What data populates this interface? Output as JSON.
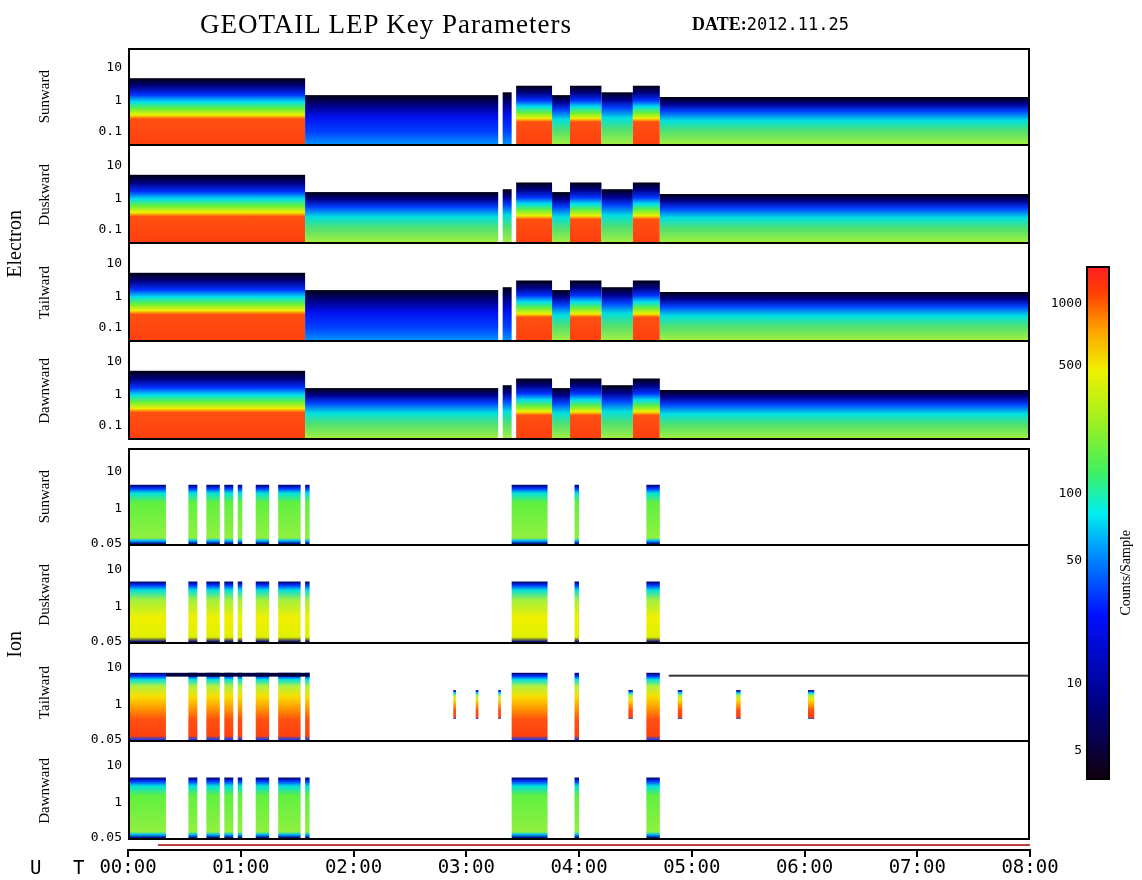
{
  "title": "GEOTAIL LEP Key Parameters",
  "date": {
    "label": "DATE:",
    "value": "2012.11.25"
  },
  "groups": [
    {
      "label": "Electron",
      "kind": "electron",
      "panels": [
        {
          "label": "Sunward",
          "ticks": [
            "10",
            "1",
            "0.1"
          ]
        },
        {
          "label": "Duskward",
          "ticks": [
            "10",
            "1",
            "0.1"
          ]
        },
        {
          "label": "Tailward",
          "ticks": [
            "10",
            "1",
            "0.1"
          ]
        },
        {
          "label": "Dawnward",
          "ticks": [
            "10",
            "1",
            "0.1"
          ]
        }
      ]
    },
    {
      "label": "Ion",
      "kind": "ion",
      "panels": [
        {
          "label": "Sunward",
          "ticks": [
            "10",
            "1",
            "0.05"
          ]
        },
        {
          "label": "Duskward",
          "ticks": [
            "10",
            "1",
            "0.05"
          ]
        },
        {
          "label": "Tailward",
          "ticks": [
            "10",
            "1",
            "0.05"
          ]
        },
        {
          "label": "Dawnward",
          "ticks": [
            "10",
            "1",
            "0.05"
          ]
        }
      ]
    }
  ],
  "time_axis": {
    "label": "U T",
    "ticks": [
      "00:00",
      "01:00",
      "02:00",
      "03:00",
      "04:00",
      "05:00",
      "06:00",
      "07:00",
      "08:00"
    ]
  },
  "colorbar": {
    "title": "Counts/Sample",
    "ticks": [
      "1000",
      "500",
      "100",
      "50",
      "10",
      "5"
    ]
  }
}
